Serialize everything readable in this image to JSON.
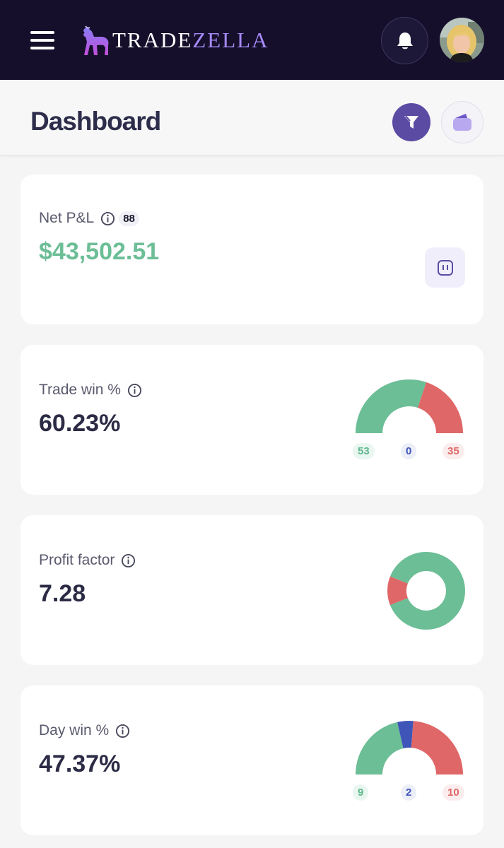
{
  "app": {
    "brand_part1": "TRADE",
    "brand_part2": "ZELLA"
  },
  "icons": {
    "menu": "hamburger-icon",
    "notifications": "bell-icon",
    "filter": "filter-icon",
    "accounts": "wallet-icon",
    "info": "info-icon",
    "gauge": "gauge-icon"
  },
  "colors": {
    "win": "#6cbe96",
    "breakeven": "#3f55b8",
    "loss": "#e06767",
    "topbar": "#150f2b",
    "accent": "#5b4ba3"
  },
  "header": {
    "title": "Dashboard"
  },
  "cards": {
    "net_pnl": {
      "label": "Net P&L",
      "trade_count": "88",
      "value": "$43,502.51"
    },
    "trade_win": {
      "label": "Trade win %",
      "value": "60.23%",
      "wins": "53",
      "breakeven": "0",
      "losses": "35"
    },
    "profit_factor": {
      "label": "Profit factor",
      "value": "7.28",
      "gross_profit_share": 0.88,
      "gross_loss_share": 0.12
    },
    "day_win": {
      "label": "Day win %",
      "value": "47.37%",
      "wins": "9",
      "breakeven": "2",
      "losses": "10"
    }
  }
}
